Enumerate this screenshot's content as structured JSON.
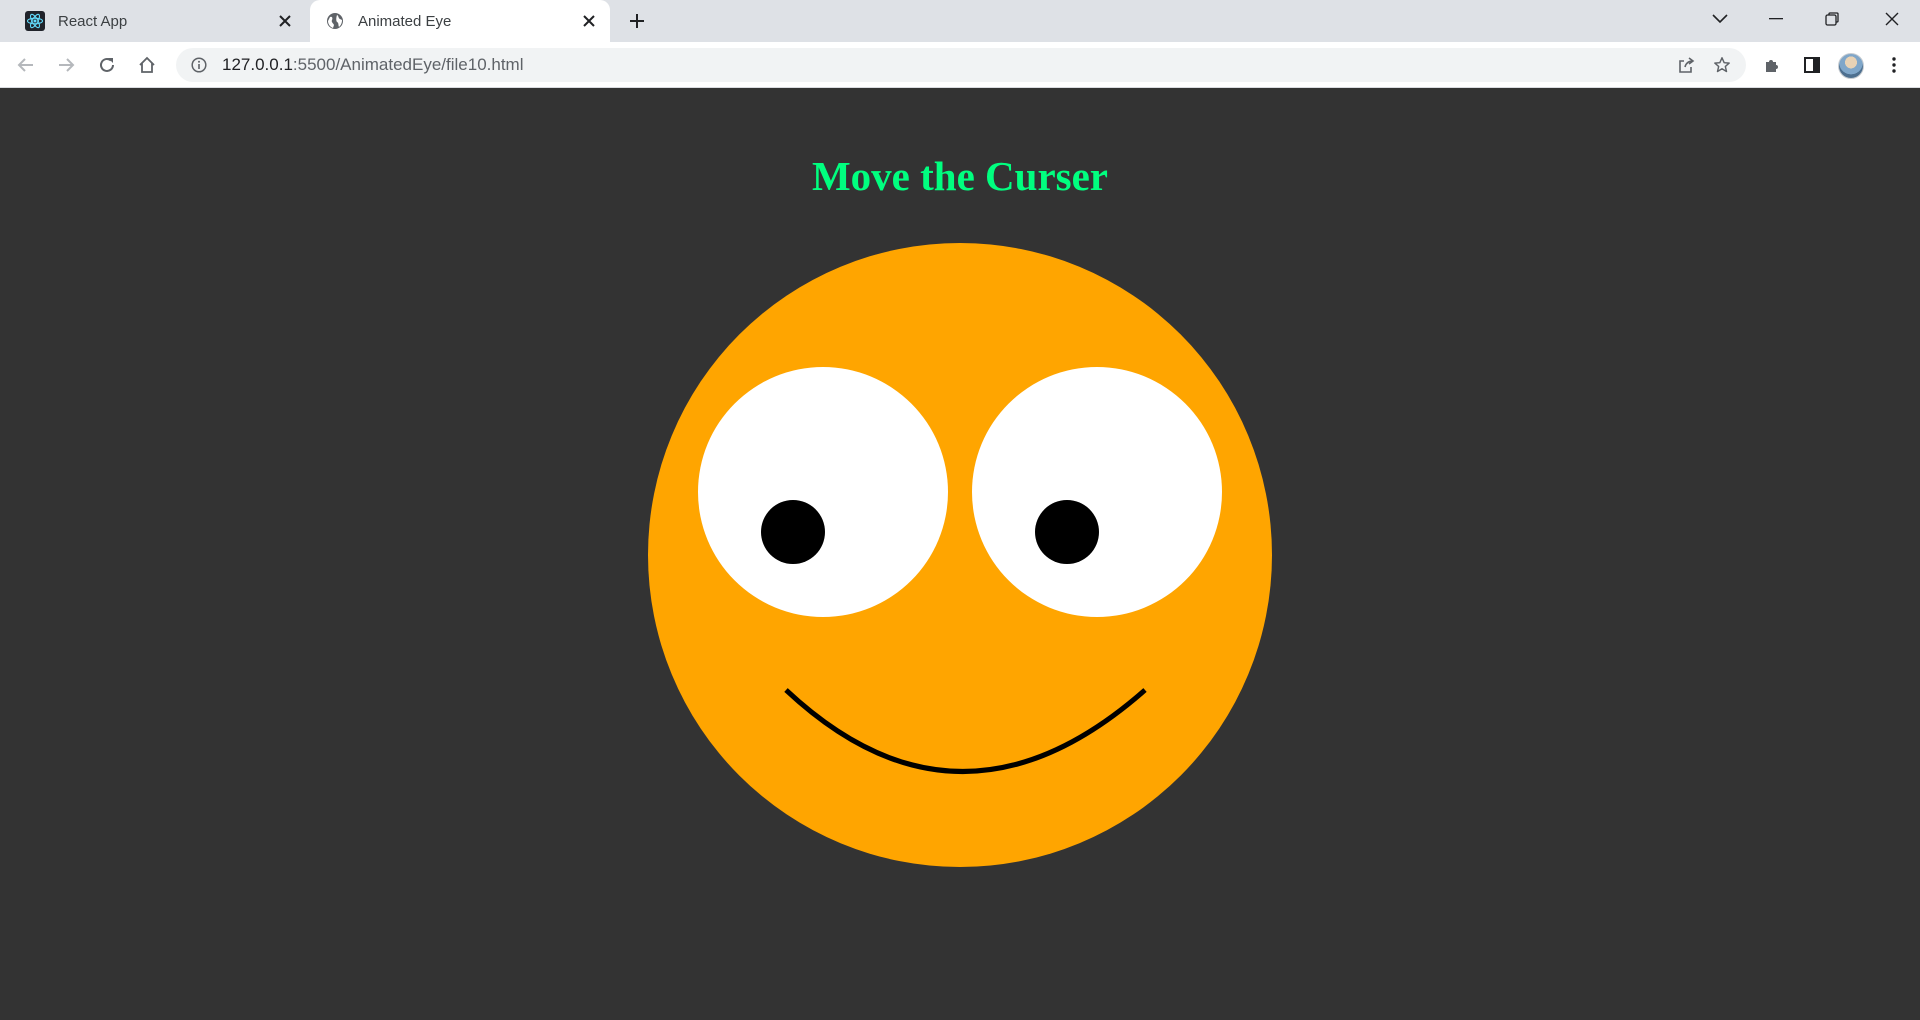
{
  "browser": {
    "tabs": [
      {
        "title": "React App",
        "active": false,
        "icon": "react-icon"
      },
      {
        "title": "Animated Eye",
        "active": true,
        "icon": "globe-icon"
      }
    ],
    "url": {
      "host": "127.0.0.1",
      "rest": ":5500/AnimatedEye/file10.html"
    }
  },
  "page": {
    "heading": "Move the Curser",
    "colors": {
      "background": "#333333",
      "heading": "#00ff7f",
      "face": "#ffa500",
      "eye": "#ffffff",
      "pupil": "#000000"
    }
  }
}
